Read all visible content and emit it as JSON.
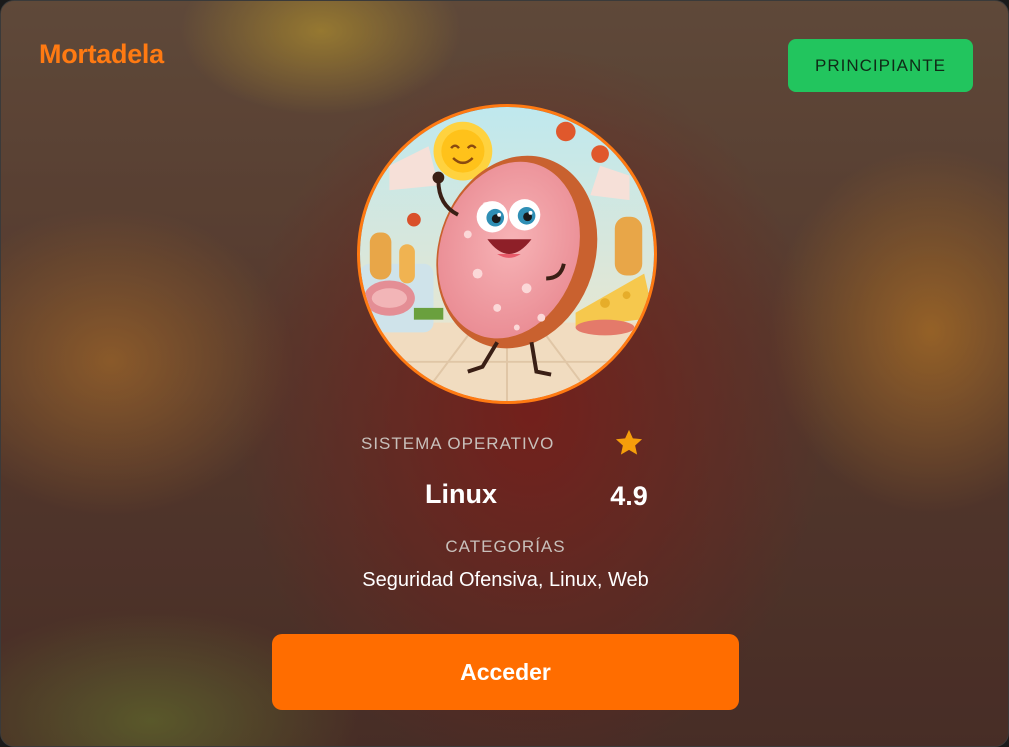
{
  "card": {
    "title": "Mortadela",
    "difficulty_badge": "PRINCIPIANTE",
    "avatar_icon": "mortadela-character-image",
    "os_label": "SISTEMA OPERATIVO",
    "os_value": "Linux",
    "rating_icon": "star-icon",
    "rating_value": "4.9",
    "categories_label": "CATEGORÍAS",
    "categories_value": "Seguridad Ofensiva, Linux, Web",
    "access_button": "Acceder"
  },
  "colors": {
    "accent": "#ff7a12",
    "button": "#ff6d00",
    "badge": "#22c55e",
    "star": "#f59e0b"
  }
}
